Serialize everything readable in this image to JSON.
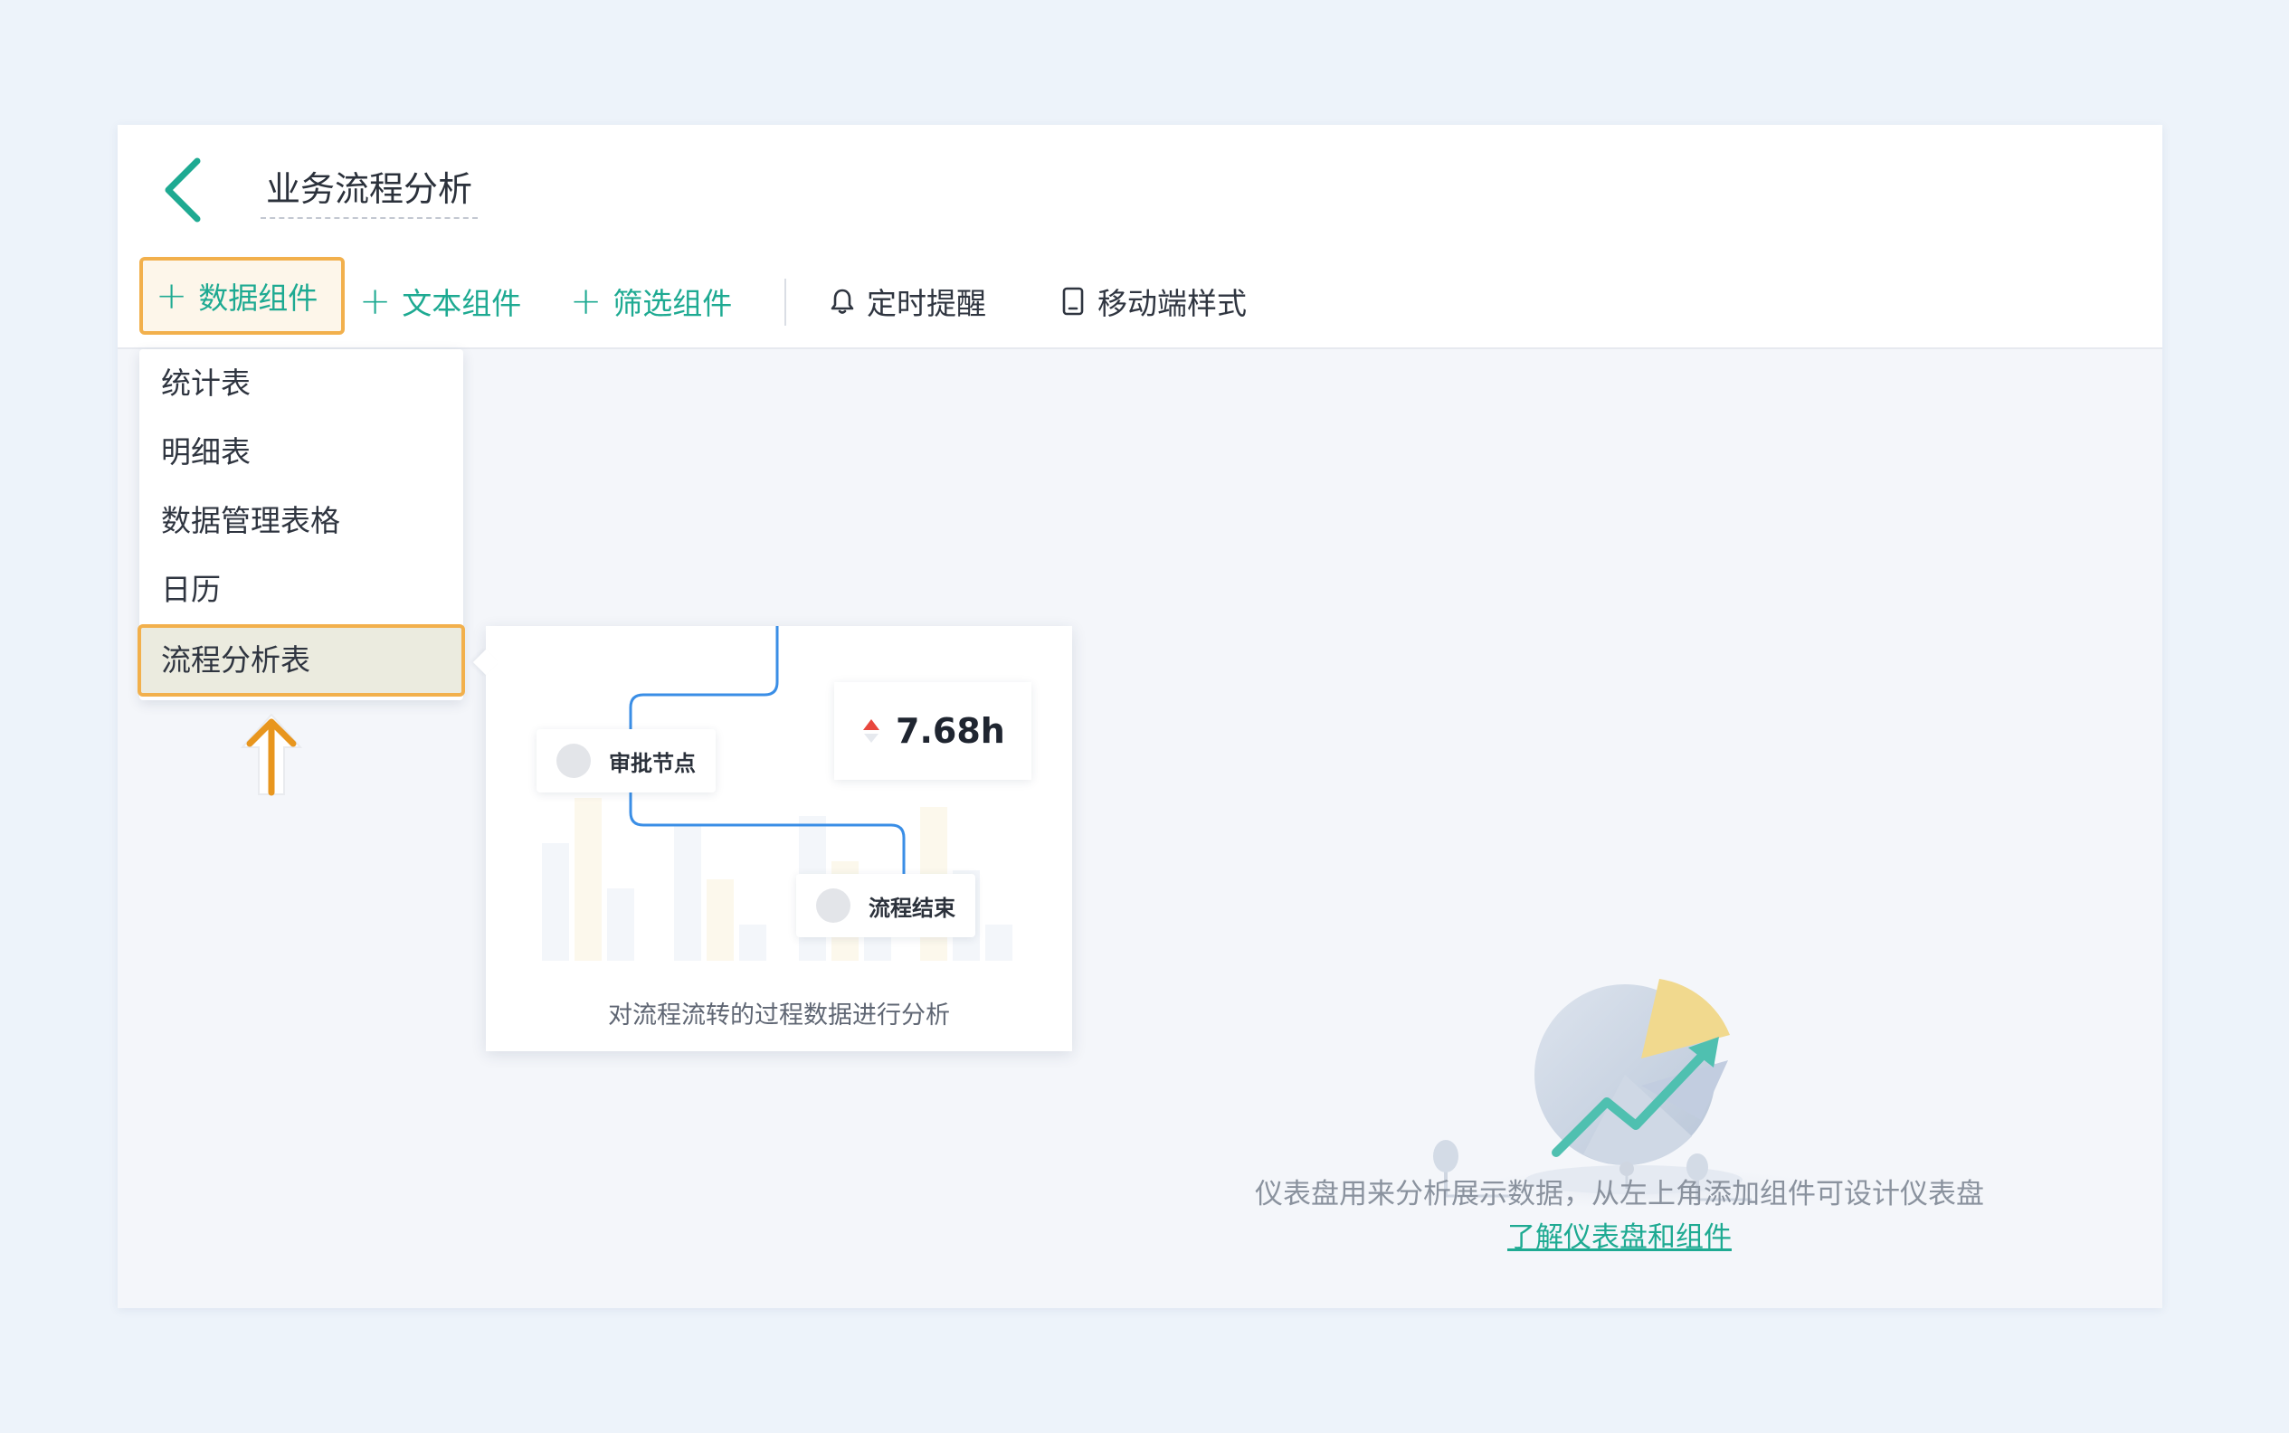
{
  "header": {
    "title": "业务流程分析"
  },
  "toolbar": {
    "data_component": "数据组件",
    "text_component": "文本组件",
    "filter_component": "筛选组件",
    "scheduled_reminder": "定时提醒",
    "mobile_style": "移动端样式"
  },
  "dropdown": {
    "items": [
      {
        "label": "统计表"
      },
      {
        "label": "明细表"
      },
      {
        "label": "数据管理表格"
      },
      {
        "label": "日历"
      },
      {
        "label": "流程分析表"
      }
    ]
  },
  "preview": {
    "node_approval": "审批节点",
    "node_end": "流程结束",
    "metric_value": "7.68h",
    "caption": "对流程流转的过程数据进行分析"
  },
  "empty_state": {
    "text": "仪表盘用来分析展示数据，从左上角添加组件可设计仪表盘",
    "link": "了解仪表盘和组件"
  },
  "colors": {
    "accent": "#1eaa92",
    "highlight_border": "#f2b04c",
    "arrow": "#e8961e",
    "flow_line": "#3a8ee6"
  }
}
